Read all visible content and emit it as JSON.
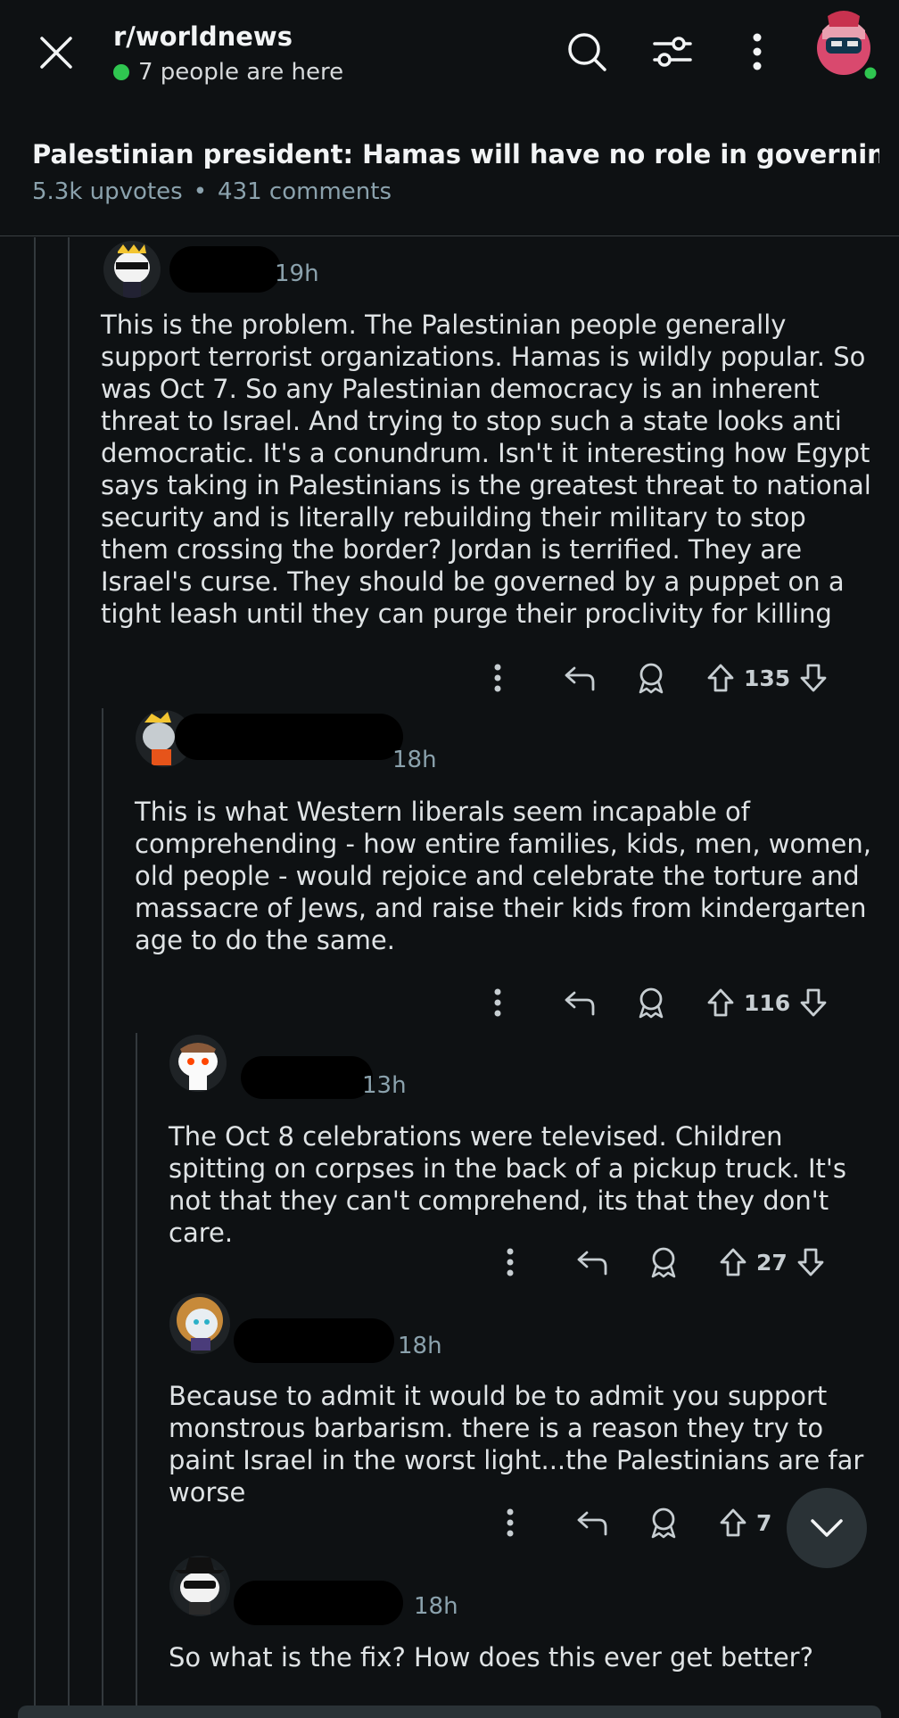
{
  "header": {
    "subreddit": "r/worldnews",
    "online_text": "7 people are here",
    "close_icon": "close-icon",
    "search_icon": "search-icon",
    "filter_icon": "sliders-icon",
    "more_icon": "more-vertical-icon",
    "online_color": "#2fc650"
  },
  "post": {
    "title": "Palestinian president: Hamas will have no role in governing post…",
    "upvotes": "5.3k upvotes",
    "separator": "•",
    "comments": "431 comments"
  },
  "comments": [
    {
      "time": "19h",
      "body": "This is the problem. The Palestinian people generally support terrorist organizations. Hamas is wildly popular. So was Oct 7. So any Palestinian democracy is an inherent threat to Israel. And trying to stop such a state looks anti democratic. It's a conundrum. Isn't it interesting how Egypt says taking in Palestinians is the greatest threat to national security and is literally rebuilding their military to stop them crossing the border? Jordan is terrified. They are Israel's curse. They should be governed by a puppet on a tight leash until they can purge their proclivity for killing",
      "votes": "135"
    },
    {
      "time": "18h",
      "body": "This is what Western liberals seem incapable of comprehending - how entire families, kids, men, women, old people - would rejoice and celebrate the torture and massacre of Jews, and raise their kids from kindergarten age to do the same.",
      "votes": "116"
    },
    {
      "time": "13h",
      "body": "The Oct 8 celebrations were televised. Children spitting on corpses in the back of a pickup truck. It's not that they can't comprehend, its that they don't care.",
      "votes": "27"
    },
    {
      "time": "18h",
      "body": "Because to admit it would be to admit you support monstrous barbarism. there is a reason they try to paint Israel in the worst light...the Palestinians are far worse",
      "votes": "7"
    },
    {
      "time": "18h",
      "body": "So what is the fix? How does this ever get better?"
    }
  ]
}
